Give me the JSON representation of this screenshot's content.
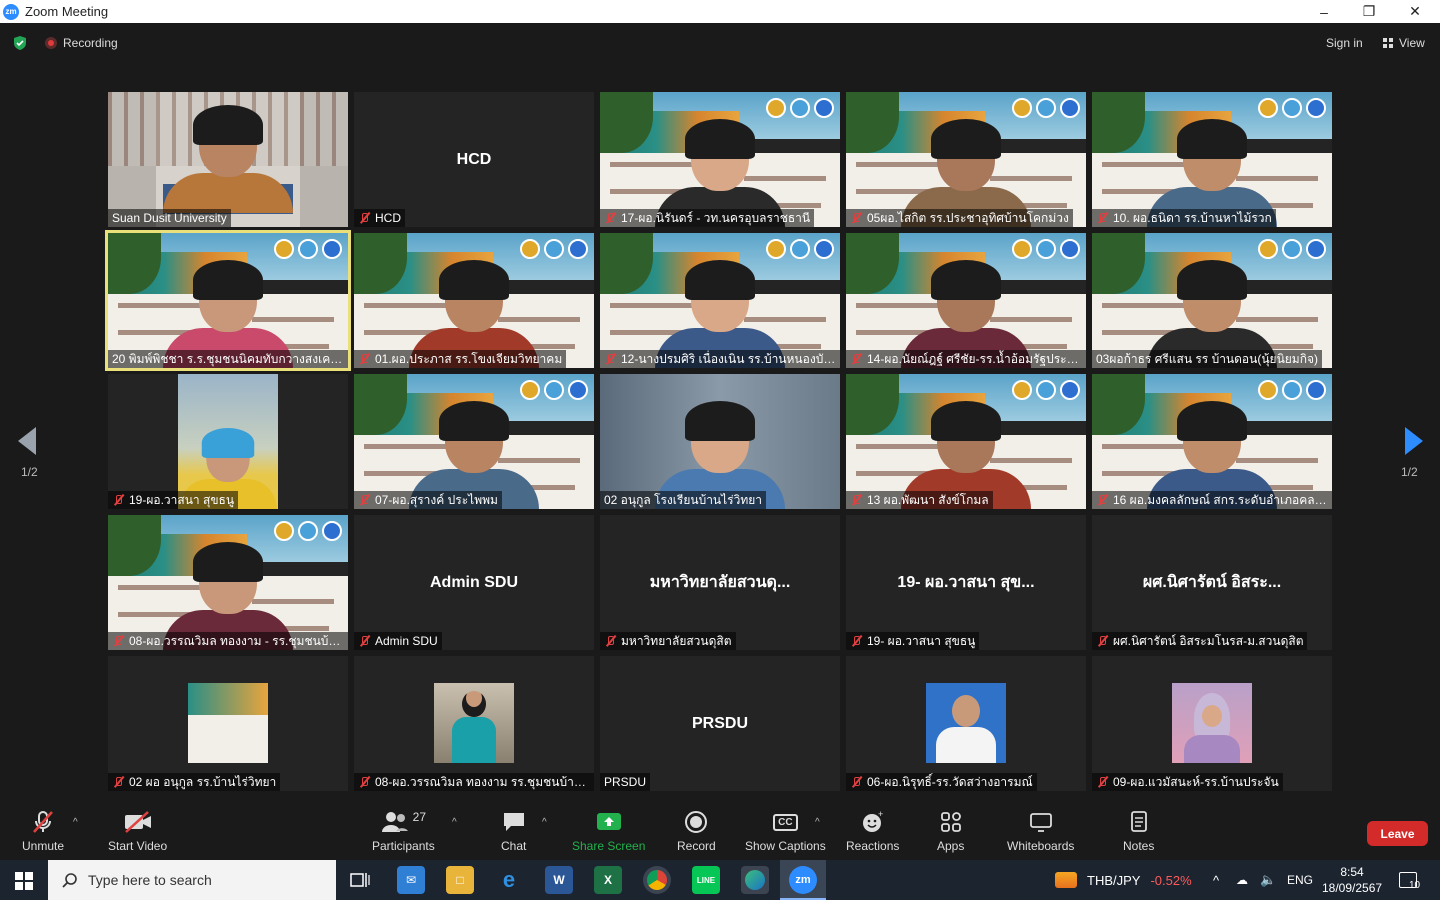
{
  "window": {
    "title": "Zoom Meeting",
    "app_icon": "zm"
  },
  "topbar": {
    "recording_label": "Recording",
    "signin_label": "Sign in",
    "view_label": "View"
  },
  "pager": {
    "left_page": "1/2",
    "right_page": "1/2"
  },
  "tiles": [
    {
      "name": "Suan Dusit University",
      "muted": false,
      "kind": "video-desk",
      "big": ""
    },
    {
      "name": "HCD",
      "muted": true,
      "kind": "name",
      "big": "HCD"
    },
    {
      "name": "17-ผอ.นิรันดร์ - วท.นครอุบลราชธานี",
      "muted": true,
      "kind": "video-banner",
      "big": ""
    },
    {
      "name": "05ผอ.ไสกิต  รร.ประชาอุทิศบ้านโคกม่วง",
      "muted": true,
      "kind": "video-banner",
      "big": ""
    },
    {
      "name": "10. ผอ.ธนิดา รร.บ้านหาไม้รวก",
      "muted": true,
      "kind": "video-banner",
      "big": ""
    },
    {
      "name": "20 พิมพ์พิชชา ร.ร.ชุมชนนิคมทับกวางสงเคราะห์",
      "muted": false,
      "kind": "video-banner",
      "big": "",
      "active": true
    },
    {
      "name": "01.ผอ.ประภาส รร.โขงเจียมวิทยาคม",
      "muted": true,
      "kind": "video-banner",
      "big": ""
    },
    {
      "name": "12-นางปรมศิริ เนื่องเนิน รร.บ้านหนองบัวแดง",
      "muted": true,
      "kind": "video-banner",
      "big": ""
    },
    {
      "name": "14-ผอ.นัยณ์ฎฐ์ ศรีชัย-รร.น้ำอ้อมรัฐประชาสรรค์",
      "muted": true,
      "kind": "video-banner",
      "big": ""
    },
    {
      "name": "03ผอก้าธร ศรีแสน รร บ้านดอน(นุ้ยนิยมกิจ)",
      "muted": false,
      "kind": "video-banner",
      "big": ""
    },
    {
      "name": "19-ผอ.วาสนา สุขธนู",
      "muted": true,
      "kind": "video-outdoor",
      "big": ""
    },
    {
      "name": "07-ผอ.สุรางค์ ประไพพม",
      "muted": true,
      "kind": "video-banner",
      "big": ""
    },
    {
      "name": "02 อนุกูล โรงเรียนบ้านไร่วิทยา",
      "muted": false,
      "kind": "video-plain",
      "big": ""
    },
    {
      "name": "13 ผอ.พัฒนา  สังข์โกมล",
      "muted": true,
      "kind": "video-banner",
      "big": ""
    },
    {
      "name": "16 ผอ.มงคลลักษณ์ สกร.ระดับอำเภอคลองหาด",
      "muted": true,
      "kind": "video-banner",
      "big": ""
    },
    {
      "name": "08-ผอ.วรรณวิมล ทองงาม - รร.ชุมชนบ้านแม่",
      "muted": true,
      "kind": "video-banner",
      "big": ""
    },
    {
      "name": "Admin SDU",
      "muted": true,
      "kind": "name",
      "big": "Admin SDU"
    },
    {
      "name": "มหาวิทยาลัยสวนดุสิต",
      "muted": true,
      "kind": "name",
      "big": "มหาวิทยาลัยสวนดุ..."
    },
    {
      "name": "19- ผอ.วาสนา สุขธนู",
      "muted": true,
      "kind": "name",
      "big": "19- ผอ.วาสนา สุข..."
    },
    {
      "name": "ผศ.นิศารัตน์ อิสระมโนรส-ม.สวนดุสิต",
      "muted": true,
      "kind": "name",
      "big": "ผศ.นิศารัตน์ อิสระ..."
    },
    {
      "name": "02 ผอ อนุกูล รร.บ้านไร่วิทยา",
      "muted": true,
      "kind": "thumb-banner",
      "big": ""
    },
    {
      "name": "08-ผอ.วรรณวิมล ทองงาม รร.ชุมชนบ้านแม่",
      "muted": true,
      "kind": "thumb-person",
      "big": ""
    },
    {
      "name": "PRSDU",
      "muted": false,
      "kind": "name",
      "big": "PRSDU"
    },
    {
      "name": "06-ผอ.นิรุทธิ์-รร.วัดสว่างอารมณ์",
      "muted": true,
      "kind": "thumb-uniform",
      "big": ""
    },
    {
      "name": "09-ผอ.แวมัสนะห์-รร.บ้านประจัน",
      "muted": true,
      "kind": "thumb-hijab",
      "big": ""
    }
  ],
  "controls": {
    "unmute": "Unmute",
    "start_video": "Start Video",
    "participants": "Participants",
    "participants_count": "27",
    "chat": "Chat",
    "share_screen": "Share Screen",
    "record": "Record",
    "show_captions": "Show Captions",
    "captions_badge": "CC",
    "reactions": "Reactions",
    "apps": "Apps",
    "whiteboards": "Whiteboards",
    "notes": "Notes",
    "leave": "Leave"
  },
  "taskbar": {
    "search_placeholder": "Type here to search",
    "zoom_icon": "zm",
    "word_icon": "W",
    "excel_icon": "X",
    "line_icon": "LINE",
    "ticker": "THB/JPY",
    "ticker_change": "-0.52%",
    "language": "ENG",
    "time": "8:54",
    "date": "18/09/2567",
    "notifications": "10"
  },
  "colors": {
    "share_green": "#22b14c",
    "leave_red": "#d32a2a",
    "active_outline": "#e9e07a",
    "ticker_red": "#ff5a5a"
  }
}
